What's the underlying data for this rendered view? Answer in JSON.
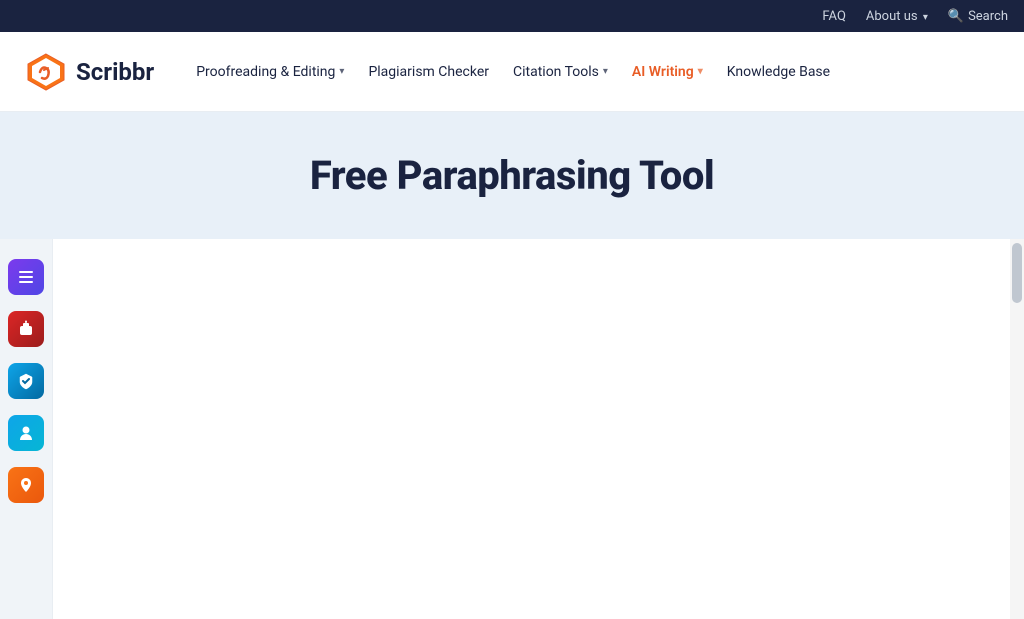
{
  "topbar": {
    "faq_label": "FAQ",
    "about_label": "About us",
    "search_label": "Search"
  },
  "nav": {
    "logo_text": "Scribbr",
    "items": [
      {
        "id": "proofreading",
        "label": "Proofreading & Editing",
        "has_dropdown": true,
        "active": false
      },
      {
        "id": "plagiarism",
        "label": "Plagiarism Checker",
        "has_dropdown": false,
        "active": false
      },
      {
        "id": "citation",
        "label": "Citation Tools",
        "has_dropdown": true,
        "active": false
      },
      {
        "id": "ai-writing",
        "label": "AI Writing",
        "has_dropdown": true,
        "active": true
      },
      {
        "id": "knowledge",
        "label": "Knowledge Base",
        "has_dropdown": false,
        "active": false
      }
    ]
  },
  "hero": {
    "title": "Free Paraphrasing Tool"
  },
  "sidebar_icons": [
    {
      "id": "list-icon",
      "color_class": "purple",
      "glyph": "≡"
    },
    {
      "id": "robot-icon",
      "color_class": "red",
      "glyph": "🤖"
    },
    {
      "id": "shield-icon",
      "color_class": "blue-shield",
      "glyph": "🛡"
    },
    {
      "id": "person-icon",
      "color_class": "teal",
      "glyph": "👤"
    },
    {
      "id": "pin-icon",
      "color_class": "orange-pin",
      "glyph": "📍"
    }
  ]
}
